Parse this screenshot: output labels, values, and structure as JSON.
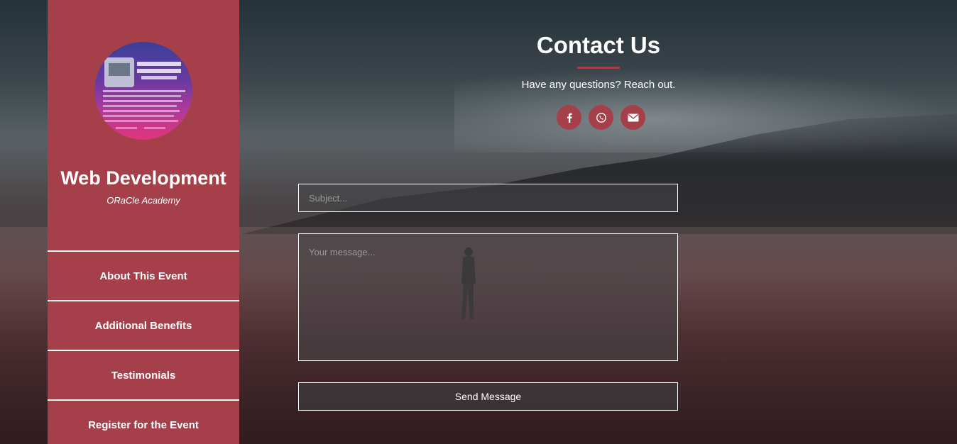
{
  "sidebar": {
    "logo_icon": "event-poster-logo",
    "title": "Web Development",
    "subtitle": "ORaCle Academy",
    "nav": [
      {
        "label": "About This Event"
      },
      {
        "label": "Additional Benefits"
      },
      {
        "label": "Testimonials"
      },
      {
        "label": "Register for the Event"
      }
    ]
  },
  "main": {
    "title": "Contact Us",
    "subtitle": "Have any questions? Reach out.",
    "social": [
      {
        "icon": "facebook-icon"
      },
      {
        "icon": "whatsapp-icon"
      },
      {
        "icon": "envelope-icon"
      }
    ],
    "form": {
      "subject_placeholder": "Subject...",
      "message_placeholder": "Your message...",
      "send_label": "Send Message"
    }
  },
  "colors": {
    "accent": "#a5404a",
    "text": "#ffffff"
  }
}
